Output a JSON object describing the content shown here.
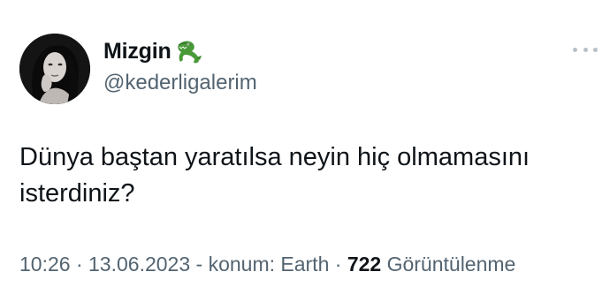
{
  "author": {
    "display_name": "Mizgin",
    "badge_icon": "crocodile-emoji-icon",
    "handle": "@kederligalerim",
    "avatar_icon": "profile-photo"
  },
  "tweet": {
    "text": "Dünya baştan yaratılsa neyin hiç olmamasını isterdiniz?",
    "time": "10:26",
    "separator_1": " · ",
    "date": "13.06.2023",
    "location_text": " - konum: Earth",
    "separator_2": " · ",
    "views_count": "722",
    "views_label": " Görüntülenme"
  },
  "menu": {
    "more_icon": "more-horizontal-icon"
  },
  "colors": {
    "text_primary": "#0f1419",
    "text_secondary": "#536471",
    "more_dots": "#b8c0c7"
  }
}
